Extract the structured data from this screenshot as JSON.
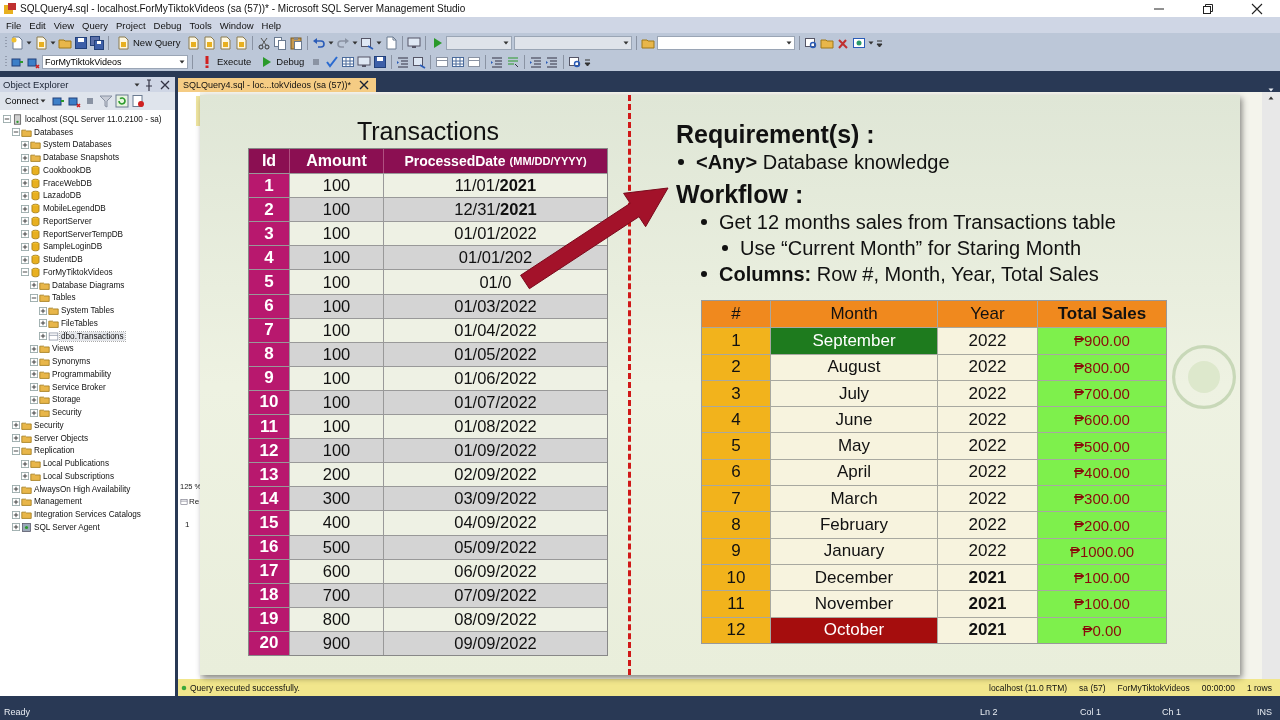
{
  "window": {
    "title": "SQLQuery4.sql - localhost.ForMyTiktokVideos (sa (57))* - Microsoft SQL Server Management Studio"
  },
  "menu": [
    "File",
    "Edit",
    "View",
    "Query",
    "Project",
    "Debug",
    "Tools",
    "Window",
    "Help"
  ],
  "toolbar_1": {
    "new_query": "New Query"
  },
  "toolbar_2": {
    "database": "ForMyTiktokVideos",
    "execute": "Execute",
    "debug": "Debug"
  },
  "object_explorer": {
    "title": "Object Explorer",
    "connect": "Connect",
    "tree": [
      {
        "label": "localhost (SQL Server 11.0.2100 - sa)",
        "kind": "server",
        "expanded": true,
        "selected": false,
        "children": [
          {
            "label": "Databases",
            "kind": "folder",
            "expanded": true,
            "selected": false,
            "children": [
              {
                "label": "System Databases",
                "kind": "folder",
                "expanded": false,
                "selected": false
              },
              {
                "label": "Database Snapshots",
                "kind": "folder",
                "expanded": false,
                "selected": false
              },
              {
                "label": "CookbookDB",
                "kind": "database",
                "expanded": false,
                "selected": false
              },
              {
                "label": "FraceWebDB",
                "kind": "database",
                "expanded": false,
                "selected": false
              },
              {
                "label": "LazadoDB",
                "kind": "database",
                "expanded": false,
                "selected": false
              },
              {
                "label": "MobileLegendDB",
                "kind": "database",
                "expanded": false,
                "selected": false
              },
              {
                "label": "ReportServer",
                "kind": "database",
                "expanded": false,
                "selected": false
              },
              {
                "label": "ReportServerTempDB",
                "kind": "database",
                "expanded": false,
                "selected": false
              },
              {
                "label": "SampleLoginDB",
                "kind": "database",
                "expanded": false,
                "selected": false
              },
              {
                "label": "StudentDB",
                "kind": "database",
                "expanded": false,
                "selected": false
              },
              {
                "label": "ForMyTiktokVideos",
                "kind": "database",
                "expanded": true,
                "selected": false,
                "children": [
                  {
                    "label": "Database Diagrams",
                    "kind": "folder",
                    "expanded": false,
                    "selected": false
                  },
                  {
                    "label": "Tables",
                    "kind": "folder",
                    "expanded": true,
                    "selected": false,
                    "children": [
                      {
                        "label": "System Tables",
                        "kind": "folder",
                        "expanded": false,
                        "selected": false
                      },
                      {
                        "label": "FileTables",
                        "kind": "folder",
                        "expanded": false,
                        "selected": false
                      },
                      {
                        "label": "dbo.Transactions",
                        "kind": "table",
                        "expanded": false,
                        "selected": true
                      }
                    ]
                  },
                  {
                    "label": "Views",
                    "kind": "folder",
                    "expanded": false,
                    "selected": false
                  },
                  {
                    "label": "Synonyms",
                    "kind": "folder",
                    "expanded": false,
                    "selected": false
                  },
                  {
                    "label": "Programmability",
                    "kind": "folder",
                    "expanded": false,
                    "selected": false
                  },
                  {
                    "label": "Service Broker",
                    "kind": "folder",
                    "expanded": false,
                    "selected": false
                  },
                  {
                    "label": "Storage",
                    "kind": "folder",
                    "expanded": false,
                    "selected": false
                  },
                  {
                    "label": "Security",
                    "kind": "folder",
                    "expanded": false,
                    "selected": false
                  }
                ]
              }
            ]
          },
          {
            "label": "Security",
            "kind": "folder",
            "expanded": false,
            "selected": false
          },
          {
            "label": "Server Objects",
            "kind": "folder",
            "expanded": false,
            "selected": false
          },
          {
            "label": "Replication",
            "kind": "folder",
            "expanded": true,
            "selected": false,
            "children": [
              {
                "label": "Local Publications",
                "kind": "folder",
                "expanded": false,
                "selected": false
              },
              {
                "label": "Local Subscriptions",
                "kind": "folder",
                "expanded": false,
                "selected": false
              }
            ]
          },
          {
            "label": "AlwaysOn High Availability",
            "kind": "folder",
            "expanded": false,
            "selected": false
          },
          {
            "label": "Management",
            "kind": "folder",
            "expanded": false,
            "selected": false
          },
          {
            "label": "Integration Services Catalogs",
            "kind": "folder",
            "expanded": false,
            "selected": false
          },
          {
            "label": "SQL Server Agent",
            "kind": "agent",
            "expanded": false,
            "selected": false
          }
        ]
      }
    ]
  },
  "editor_tab": {
    "label": "SQLQuery4.sql - loc...tokVideos (sa (57))*",
    "selected": true
  },
  "results_pane": {
    "zoom": "125 %",
    "tab": "Re",
    "row_number": "1"
  },
  "slide": {
    "transactions": {
      "title": "Transactions",
      "columns": [
        {
          "label": "Id"
        },
        {
          "label": "Amount"
        },
        {
          "label": "ProcessedDate",
          "note": "(MM/DD/YYYY)"
        }
      ],
      "rows": [
        {
          "id": "1",
          "amount": "100",
          "date": "11/01/**2021**"
        },
        {
          "id": "2",
          "amount": "100",
          "date": "12/31/**2021**"
        },
        {
          "id": "3",
          "amount": "100",
          "date": "01/01/2022"
        },
        {
          "id": "4",
          "amount": "100",
          "date": "01/01/202"
        },
        {
          "id": "5",
          "amount": "100",
          "date": "01/0"
        },
        {
          "id": "6",
          "amount": "100",
          "date": "01/03/2022"
        },
        {
          "id": "7",
          "amount": "100",
          "date": "01/04/2022"
        },
        {
          "id": "8",
          "amount": "100",
          "date": "01/05/2022"
        },
        {
          "id": "9",
          "amount": "100",
          "date": "01/06/2022"
        },
        {
          "id": "10",
          "amount": "100",
          "date": "01/07/2022"
        },
        {
          "id": "11",
          "amount": "100",
          "date": "01/08/2022"
        },
        {
          "id": "12",
          "amount": "100",
          "date": "01/09/2022"
        },
        {
          "id": "13",
          "amount": "200",
          "date": "02/09/2022"
        },
        {
          "id": "14",
          "amount": "300",
          "date": "03/09/2022"
        },
        {
          "id": "15",
          "amount": "400",
          "date": "04/09/2022"
        },
        {
          "id": "16",
          "amount": "500",
          "date": "05/09/2022"
        },
        {
          "id": "17",
          "amount": "600",
          "date": "06/09/2022"
        },
        {
          "id": "18",
          "amount": "700",
          "date": "07/09/2022"
        },
        {
          "id": "19",
          "amount": "800",
          "date": "08/09/2022"
        },
        {
          "id": "20",
          "amount": "900",
          "date": "09/09/2022"
        }
      ]
    },
    "requirements": {
      "title": "Requirement(s) :",
      "items": [
        {
          "text": "**<Any>** Database knowledge"
        }
      ]
    },
    "workflow": {
      "title": "Workflow :",
      "items": [
        {
          "text": "Get 12 months sales from Transactions table",
          "children": [
            {
              "text": "Use “Current Month” for Staring Month"
            }
          ]
        },
        {
          "text": "**Columns:** Row #, Month, Year, Total Sales"
        }
      ]
    },
    "sales": {
      "columns": [
        "#",
        "Month",
        "Year",
        "Total Sales"
      ],
      "rows": [
        {
          "n": "1",
          "month": "September",
          "color": "#1e7b1e",
          "year": "2022",
          "bold_year": false,
          "total": "₱900.00"
        },
        {
          "n": "2",
          "month": "August",
          "color": "#f7f3de",
          "year": "2022",
          "bold_year": false,
          "total": "₱800.00"
        },
        {
          "n": "3",
          "month": "July",
          "color": "#f7f3de",
          "year": "2022",
          "bold_year": false,
          "total": "₱700.00"
        },
        {
          "n": "4",
          "month": "June",
          "color": "#f7f3de",
          "year": "2022",
          "bold_year": false,
          "total": "₱600.00"
        },
        {
          "n": "5",
          "month": "May",
          "color": "#f7f3de",
          "year": "2022",
          "bold_year": false,
          "total": "₱500.00"
        },
        {
          "n": "6",
          "month": "April",
          "color": "#f7f3de",
          "year": "2022",
          "bold_year": false,
          "total": "₱400.00"
        },
        {
          "n": "7",
          "month": "March",
          "color": "#f7f3de",
          "year": "2022",
          "bold_year": false,
          "total": "₱300.00"
        },
        {
          "n": "8",
          "month": "February",
          "color": "#f7f3de",
          "year": "2022",
          "bold_year": false,
          "total": "₱200.00"
        },
        {
          "n": "9",
          "month": "January",
          "color": "#f7f3de",
          "year": "2022",
          "bold_year": false,
          "total": "₱1000.00"
        },
        {
          "n": "10",
          "month": "December",
          "color": "#f7f3de",
          "year": "2021",
          "bold_year": true,
          "total": "₱100.00"
        },
        {
          "n": "11",
          "month": "November",
          "color": "#f7f3de",
          "year": "2021",
          "bold_year": true,
          "total": "₱100.00"
        },
        {
          "n": "12",
          "month": "October",
          "color": "#a50d0d",
          "year": "2021",
          "bold_year": true,
          "total": "₱0.00"
        }
      ]
    }
  },
  "query_status": {
    "message": "Query executed successfully.",
    "server": "localhost (11.0 RTM)",
    "user": "sa (57)",
    "database": "ForMyTiktokVideos",
    "elapsed": "00:00:00",
    "rows": "1 rows"
  },
  "status_bar": {
    "state": "Ready",
    "line": "Ln 2",
    "column": "Col 1",
    "char": "Ch 1",
    "mode": "INS"
  }
}
